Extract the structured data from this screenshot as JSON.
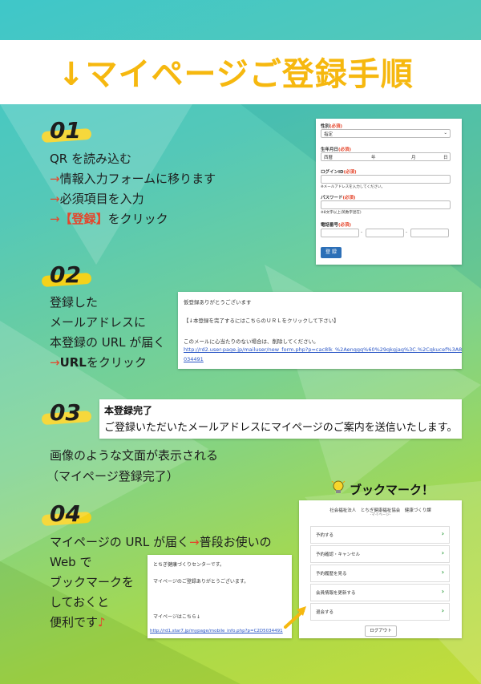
{
  "header": {
    "title": "↓マイページご登録手順"
  },
  "step1": {
    "number": "01",
    "lines": [
      "QR を読み込む",
      "情報入力フォームに移ります",
      "必須項目を入力",
      "【登録】",
      "をクリック"
    ],
    "arrow": "→",
    "form": {
      "gender_label": "性別",
      "gender_value": "指定",
      "birth_label": "生年月日",
      "era": "西暦",
      "year": "年",
      "month": "月",
      "day": "日",
      "login_label": "ログインID",
      "login_hint": "※メールアドレスを入力してください。",
      "password_label": "パスワード",
      "password_hint": "※8文字以上(英数字混在)",
      "phone_label": "電話番号",
      "dash": "-",
      "required": "(必須)",
      "submit": "登 録"
    }
  },
  "step2": {
    "number": "02",
    "lines": [
      "登録した",
      "メールアドレスに",
      "本登録の URL が届く",
      "URL",
      "をクリック"
    ],
    "arrow": "→",
    "mail": {
      "line1": "仮登録ありがとうございます",
      "line2": "【↓本登録を完了するにはこちらのＵＲＬをクリックして下さい】",
      "line3": "このメールに心当たりのない場合は、削除してください。",
      "link1": "http://rd2.user-page.jp/mailuser/new_form.php?p=cac8lk_%2Aenqgq%60%29qkgjag%3C.%2Cqkucef%3A8-",
      "link2": "034491"
    }
  },
  "step3": {
    "number": "03",
    "done_title": "本登録完了",
    "done_body": "ご登録いただいたメールアドレスにマイページのご案内を送信いたします。",
    "lines": [
      "画像のような文面が表示される",
      "（マイページ登録完了）"
    ]
  },
  "step4": {
    "number": "04",
    "line1a": "マイページの URL が届く",
    "arrow": "→",
    "line1b": "普段お使いの",
    "lines": [
      "Web で",
      "ブックマークを",
      "しておくと",
      "便利です"
    ],
    "note_icon": "♪",
    "bookmark_label": "ブックマーク！",
    "mail": {
      "line1": "とちぎ健康づくりセンターです。",
      "line2": "マイページのご登録ありがとうございます。",
      "line3": "マイページはこちら↓",
      "link": "http://rd1.star7.jp/mypage/mobile_info.php?p=C2D5034491"
    },
    "mypage": {
      "head": "社会福祉法人　とちぎ健康福祉協会　健康づくり課",
      "sub": "-マイページ-",
      "items": [
        "予約する",
        "予約確認・キャンセル",
        "予約履歴を見る",
        "会員情報を更新する",
        "退会する"
      ],
      "chevron": "›",
      "logout": "ログアウト"
    }
  },
  "colors": {
    "accent": "#f6b80f",
    "red": "#e5452b",
    "link": "#2a56c6"
  }
}
